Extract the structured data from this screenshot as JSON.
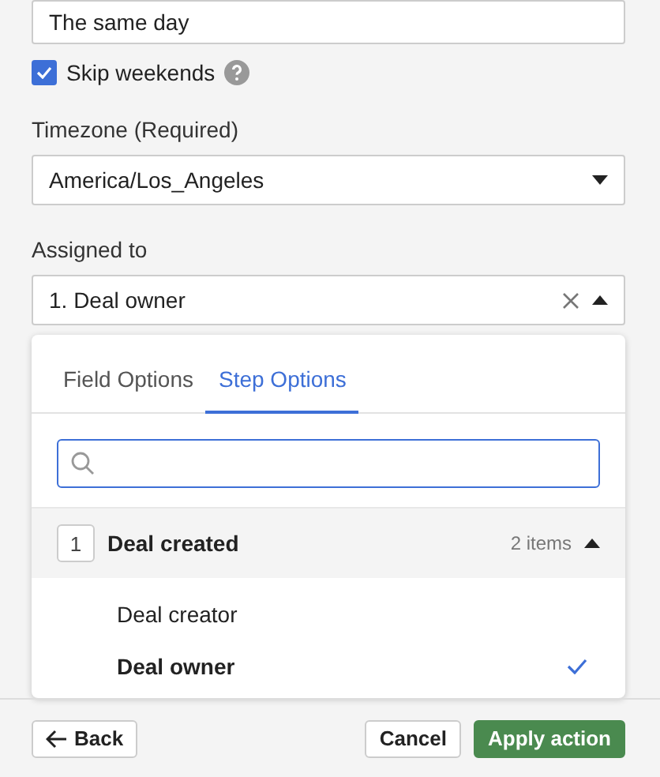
{
  "top_field": {
    "value": "The same day"
  },
  "skip_weekends": {
    "label": "Skip weekends",
    "checked": true
  },
  "timezone": {
    "label": "Timezone (Required)",
    "value": "America/Los_Angeles"
  },
  "assigned_to": {
    "label": "Assigned to",
    "value": "1. Deal owner",
    "expanded": true,
    "dropdown": {
      "tabs": [
        {
          "label": "Field Options",
          "selected": false
        },
        {
          "label": "Step Options",
          "selected": true
        }
      ],
      "groups": [
        {
          "number": "1",
          "title": "Deal created",
          "count": "2 items",
          "expanded": true,
          "items": [
            {
              "label": "Deal creator",
              "selected": false
            },
            {
              "label": "Deal owner",
              "selected": true
            }
          ]
        }
      ]
    }
  },
  "footer": {
    "back": "Back",
    "cancel": "Cancel",
    "apply": "Apply action"
  }
}
